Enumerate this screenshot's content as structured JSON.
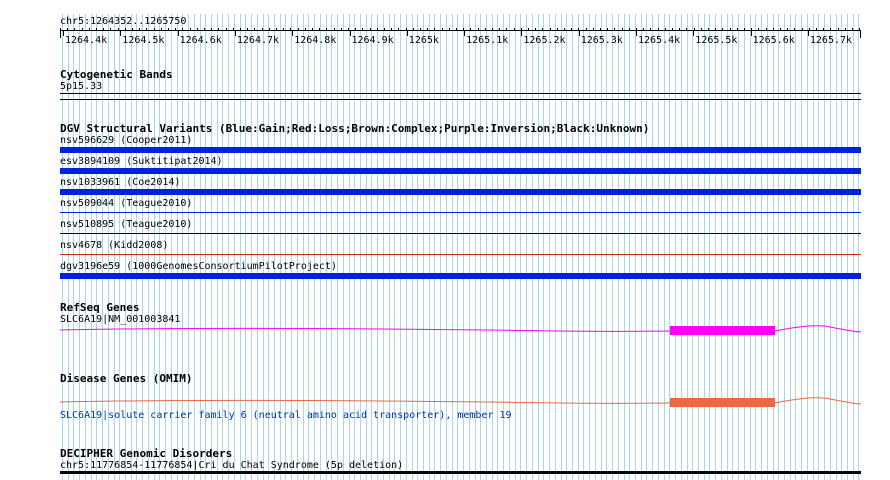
{
  "ruler": {
    "region": "chr5:1264352..1265750",
    "ticks": [
      "1264.4k",
      "1264.5k",
      "1264.6k",
      "1264.7k",
      "1264.8k",
      "1264.9k",
      "1265k",
      "1265.1k",
      "1265.2k",
      "1265.3k",
      "1265.4k",
      "1265.5k",
      "1265.6k",
      "1265.7k"
    ]
  },
  "cytoband": {
    "title": "Cytogenetic Bands",
    "band": "5p15.33"
  },
  "dgv": {
    "title": "DGV Structural Variants (Blue:Gain;Red:Loss;Brown:Complex;Purple:Inversion;Black:Unknown)",
    "variants": [
      "nsv596629 (Cooper2011)",
      "esv3894109 (Suktitipat2014)",
      "nsv1033961 (Coe2014)",
      "nsv509044 (Teague2010)",
      "nsv510895 (Teague2010)",
      "nsv4678 (Kidd2008)",
      "dgv3196e59 (1000GenomesConsortiumPilotProject)"
    ]
  },
  "refseq": {
    "title": "RefSeq Genes",
    "gene": "SLC6A19|NM_001003841",
    "color": "#ff00ff"
  },
  "omim": {
    "title": "Disease Genes (OMIM)",
    "gene": "SLC6A19|solute carrier family 6 (neutral amino acid transporter), member 19",
    "color": "#ee6644"
  },
  "decipher": {
    "title": "DECIPHER Genomic Disorders",
    "item": "chr5:11776854-11776854|Cri du Chat Syndrome (5p deletion)"
  },
  "colors": {
    "grid": "#a8d8e8",
    "gain": "#0022dd",
    "loss": "#cc2222"
  }
}
